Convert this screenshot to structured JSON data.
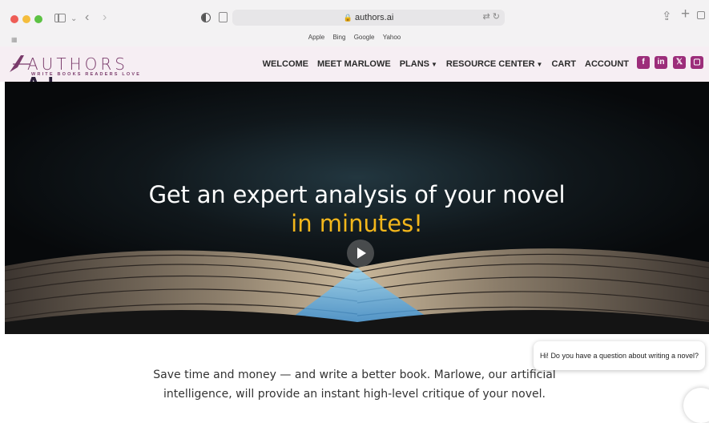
{
  "browser": {
    "url": "authors.ai",
    "favorites": [
      "Apple",
      "Bing",
      "Google",
      "Yahoo"
    ]
  },
  "site": {
    "logo_wordmark": "AUTHORS",
    "logo_suffix": "A.I.",
    "logo_tagline": "WRITE BOOKS READERS LOVE",
    "nav": [
      {
        "label": "WELCOME"
      },
      {
        "label": "MEET MARLOWE"
      },
      {
        "label": "PLANS",
        "dropdown": true
      },
      {
        "label": "RESOURCE CENTER",
        "dropdown": true
      },
      {
        "label": "CART"
      },
      {
        "label": "ACCOUNT"
      }
    ],
    "social_icons": [
      "facebook-icon",
      "linkedin-icon",
      "x-icon",
      "calendar-icon"
    ],
    "brand_color": "#9c2d7a",
    "accent_color": "#f2b61b"
  },
  "hero": {
    "title": "Get an expert analysis of your novel",
    "accent": "in minutes!"
  },
  "body": {
    "line1": "Save time and money — and write a better book. Marlowe, our artificial",
    "line2": "intelligence, will provide an instant high-level critique of your novel."
  },
  "chat": {
    "message": "Hi! Do you have a question about writing a novel?"
  }
}
